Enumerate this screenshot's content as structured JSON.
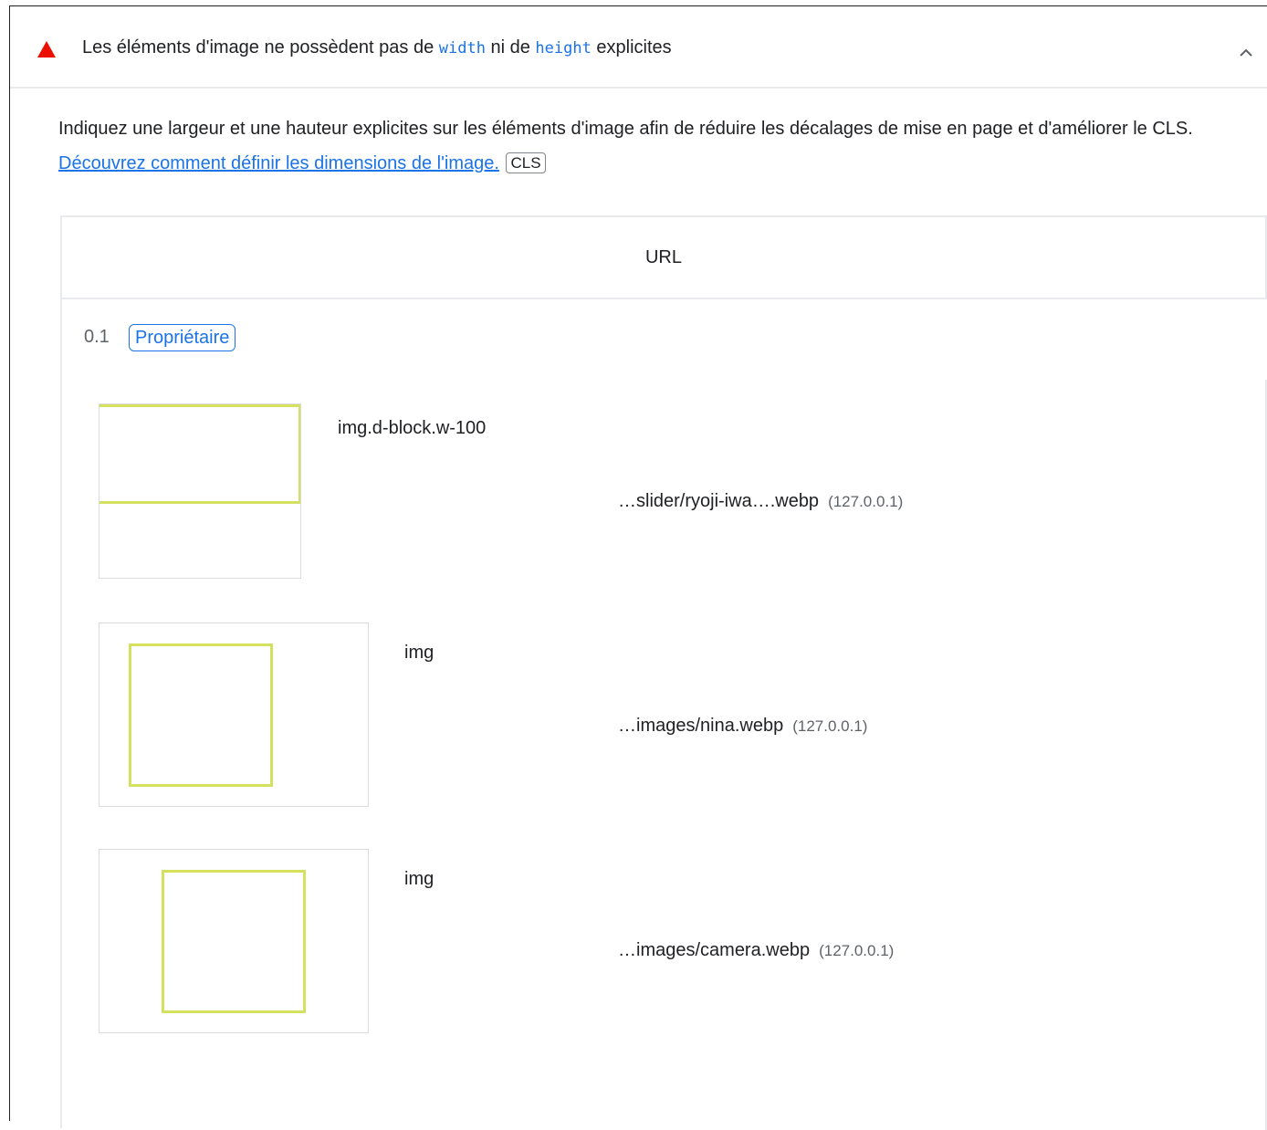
{
  "audit": {
    "title_before": "Les éléments d'image ne possèdent pas de ",
    "code_width": "width",
    "title_middle": " ni de ",
    "code_height": "height",
    "title_after": " explicites",
    "status_color": "#eb0f00",
    "status_icon": "fail-triangle-icon",
    "toggle_icon": "chevron-up-icon"
  },
  "description": {
    "text": "Indiquez une largeur et une hauteur explicites sur les éléments d'image afin de réduire les décalages de mise en page et d'améliorer le CLS. ",
    "link_text": "Découvrez comment définir les dimensions de l'image.",
    "metric_tag": "CLS"
  },
  "table": {
    "headers": [
      "URL"
    ],
    "group": {
      "label": "0.1",
      "badge": "Propriétaire"
    },
    "rows": [
      {
        "node": "img.d-block.w-100",
        "url": "…slider/ryoji-iwa….webp",
        "host": "(127.0.0.1)"
      },
      {
        "node": "img",
        "url": "…images/nina.webp",
        "host": "(127.0.0.1)"
      },
      {
        "node": "img",
        "url": "…images/camera.webp",
        "host": "(127.0.0.1)"
      }
    ]
  },
  "colors": {
    "accent": "#1a73e8",
    "highlight": "#d4e15f",
    "border": "#e8eaed"
  }
}
